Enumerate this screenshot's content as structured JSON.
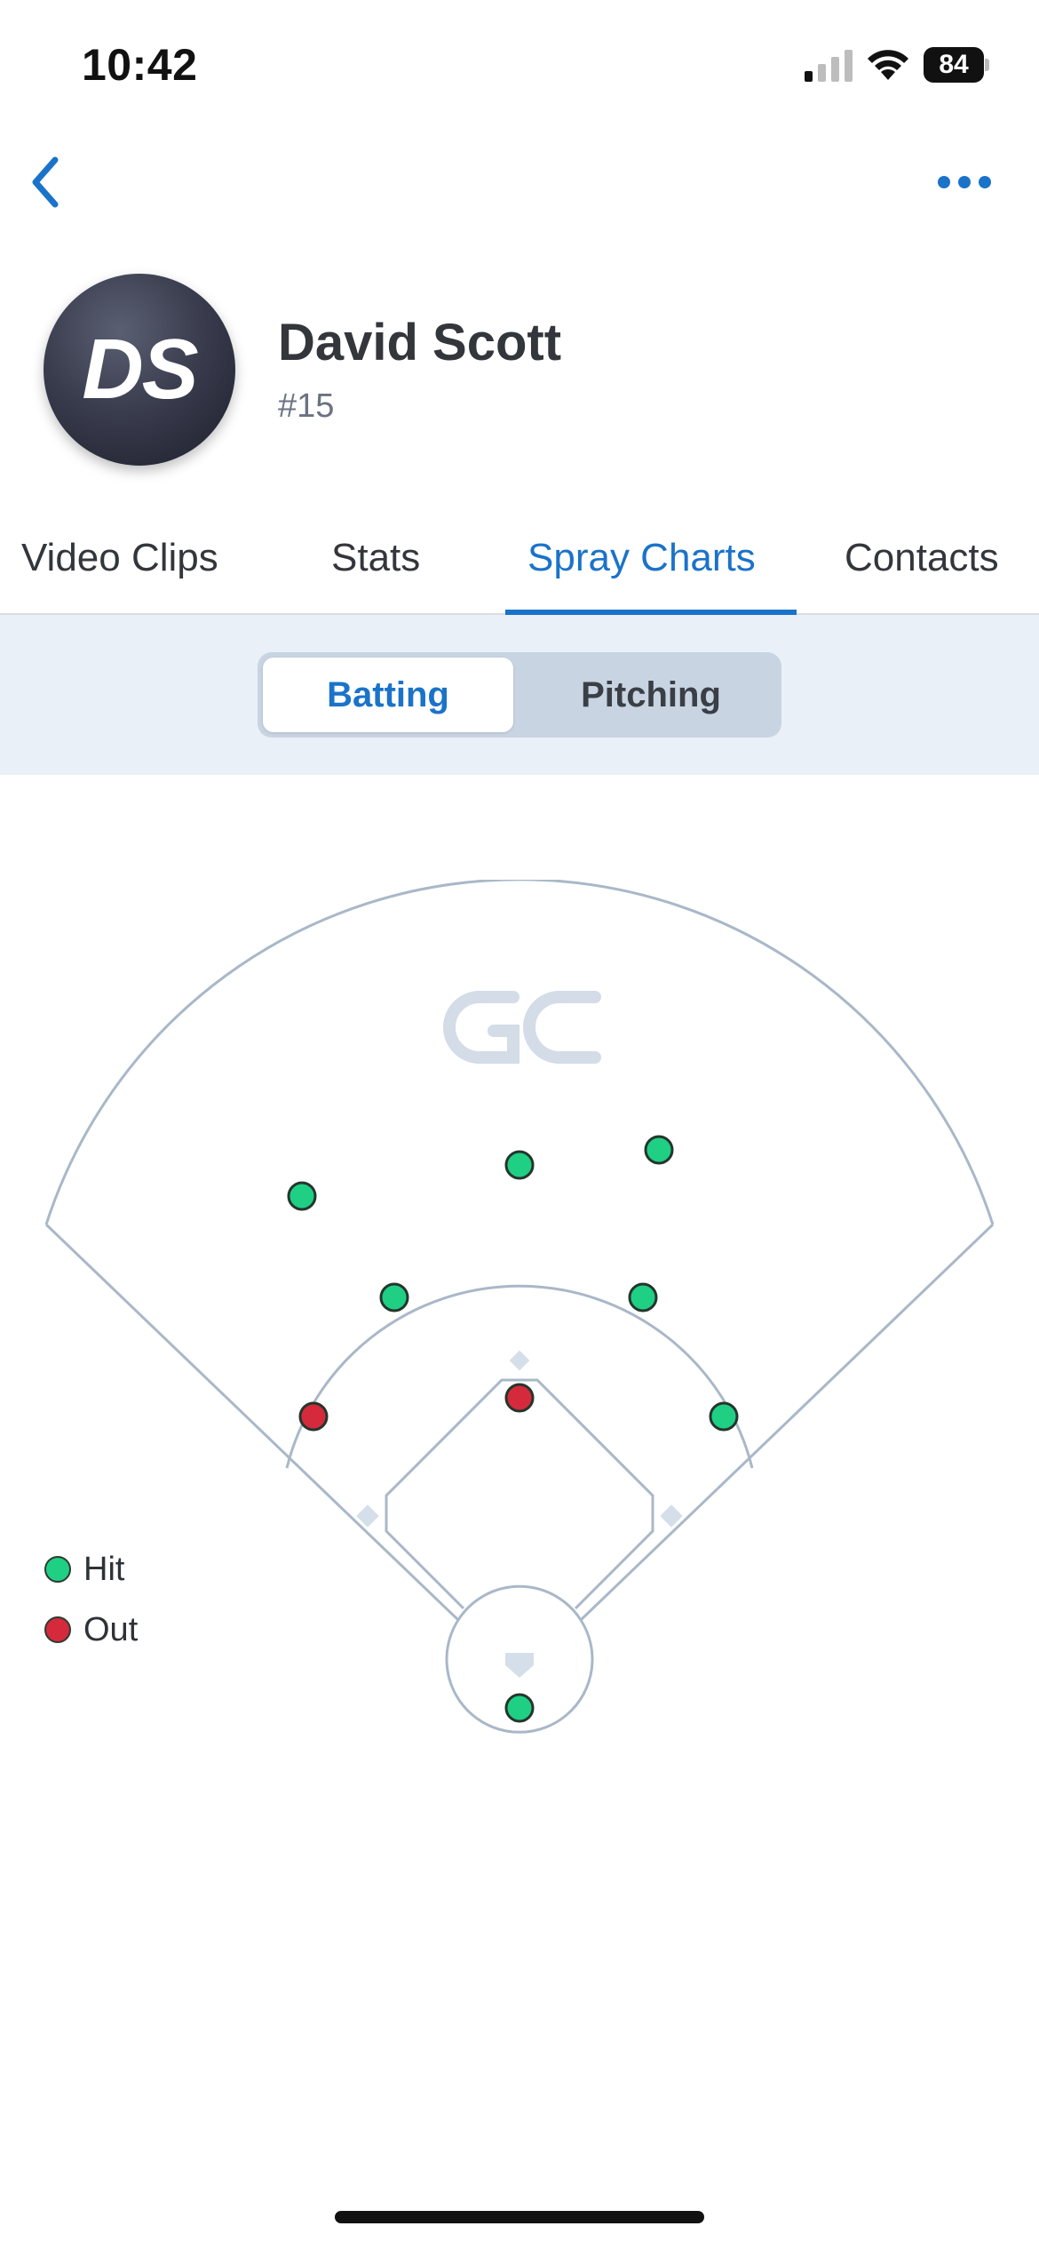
{
  "status_bar": {
    "time": "10:42",
    "battery_level": "84",
    "icons": [
      "cellular-signal-icon",
      "wifi-icon",
      "battery-icon"
    ]
  },
  "nav": {
    "back_icon": "chevron-left-icon",
    "more_icon": "ellipsis-icon",
    "accent_color": "#1a73c9"
  },
  "player": {
    "initials": "DS",
    "name": "David Scott",
    "number": "#15"
  },
  "tabs": [
    {
      "label": "Video Clips",
      "active": false
    },
    {
      "label": "Stats",
      "active": false
    },
    {
      "label": "Spray Charts",
      "active": true
    },
    {
      "label": "Contacts",
      "active": false
    }
  ],
  "segmented_control": {
    "options": [
      "Batting",
      "Pitching"
    ],
    "selected": "Batting"
  },
  "spray_chart": {
    "watermark": "GC",
    "hit_color": "#1fcf84",
    "out_color": "#d42a3c",
    "legend": [
      {
        "label": "Hit",
        "type": "hit"
      },
      {
        "label": "Out",
        "type": "out"
      }
    ],
    "results": [
      {
        "type": "hit",
        "location": "left-center field"
      },
      {
        "type": "hit",
        "location": "center field"
      },
      {
        "type": "hit",
        "location": "right-center field"
      },
      {
        "type": "hit",
        "location": "shallow left-center"
      },
      {
        "type": "hit",
        "location": "shallow right-center"
      },
      {
        "type": "out",
        "location": "left field line, infield arc"
      },
      {
        "type": "out",
        "location": "second base"
      },
      {
        "type": "hit",
        "location": "right field line, infield arc"
      },
      {
        "type": "hit",
        "location": "home plate area"
      }
    ]
  }
}
